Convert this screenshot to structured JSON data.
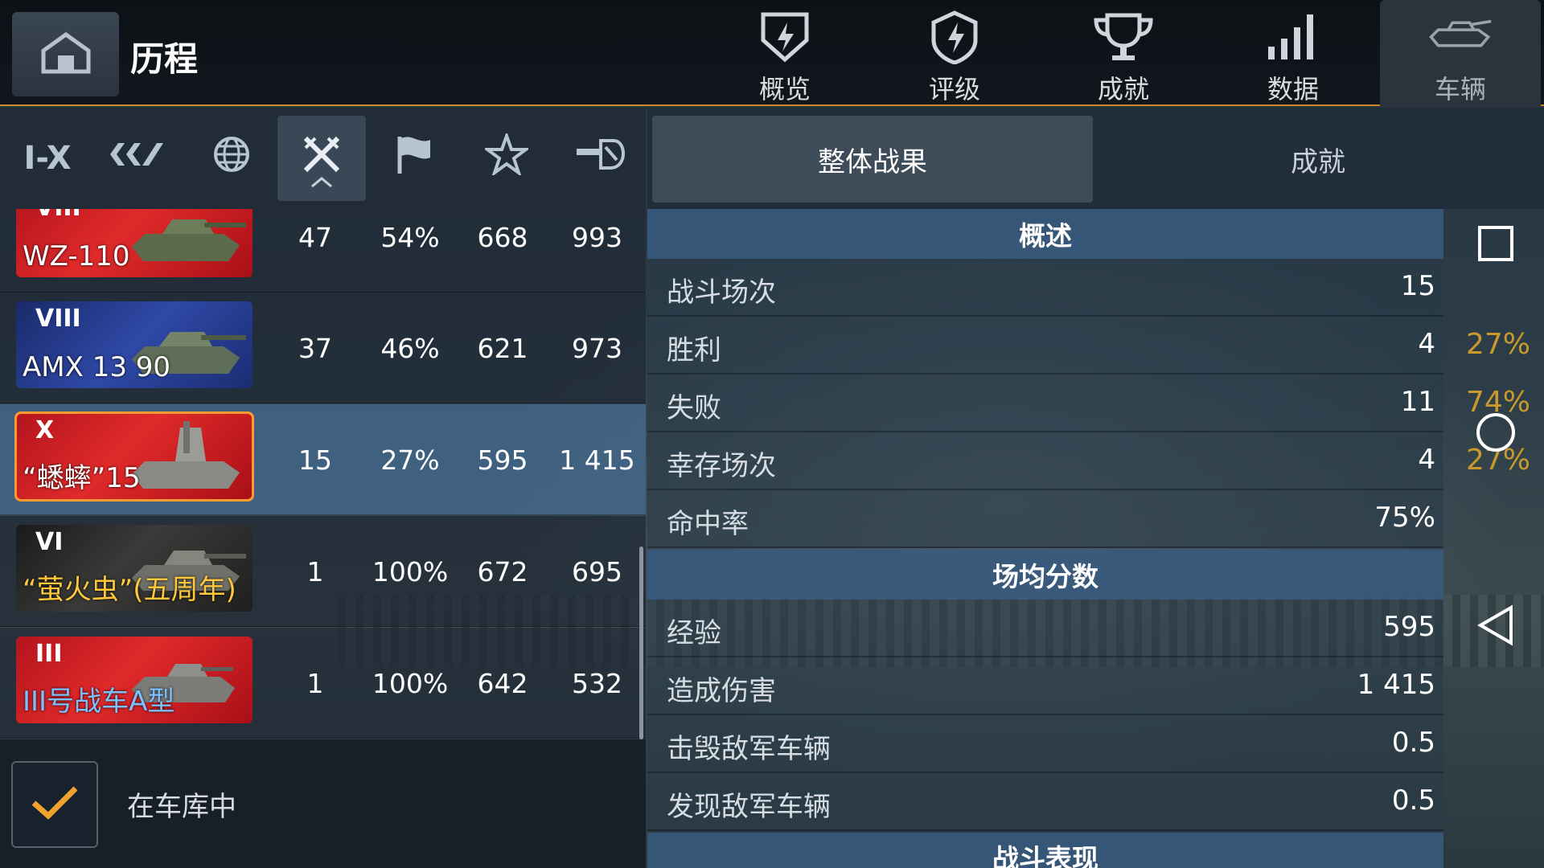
{
  "header": {
    "title": "历程",
    "nav": [
      {
        "label": "概览",
        "icon": "shield-icon"
      },
      {
        "label": "评级",
        "icon": "rating-icon"
      },
      {
        "label": "成就",
        "icon": "trophy-icon"
      },
      {
        "label": "数据",
        "icon": "bars-icon"
      },
      {
        "label": "车辆",
        "icon": "tank-icon"
      }
    ]
  },
  "filters": {
    "tier_label": "I-X",
    "icons": [
      "tier-filter-icon",
      "nation-icon",
      "globe-icon",
      "crossed-swords-icon",
      "flag-icon",
      "star-icon",
      "gun-icon"
    ]
  },
  "tabs": {
    "overall": "整体战果",
    "achievements": "成就"
  },
  "vehicles": [
    {
      "tier": "VIII",
      "name": "WZ-110",
      "battles": "47",
      "winrate": "54%",
      "xp": "668",
      "dmg": "993",
      "color": "red"
    },
    {
      "tier": "VIII",
      "name": "AMX 13 90",
      "battles": "37",
      "winrate": "46%",
      "xp": "621",
      "dmg": "973",
      "color": "blue"
    },
    {
      "tier": "X",
      "name": "“蟋蟀”15",
      "battles": "15",
      "winrate": "27%",
      "xp": "595",
      "dmg": "1 415",
      "color": "red"
    },
    {
      "tier": "VI",
      "name": "“萤火虫”(五周年)",
      "battles": "1",
      "winrate": "100%",
      "xp": "672",
      "dmg": "695",
      "color": "black"
    },
    {
      "tier": "III",
      "name": "III号战车A型",
      "battles": "1",
      "winrate": "100%",
      "xp": "642",
      "dmg": "532",
      "color": "red"
    }
  ],
  "garage_filter": {
    "label": "在车库中",
    "checked": true
  },
  "stats": {
    "overview_title": "概述",
    "battles": {
      "label": "战斗场次",
      "value": "15"
    },
    "wins": {
      "label": "胜利",
      "value": "4",
      "pct": "27%"
    },
    "losses": {
      "label": "失败",
      "value": "11",
      "pct": "74%"
    },
    "survived": {
      "label": "幸存场次",
      "value": "4",
      "pct": "27%"
    },
    "hit_rate": {
      "label": "命中率",
      "value": "75%"
    },
    "avg_title": "场均分数",
    "xp": {
      "label": "经验",
      "value": "595"
    },
    "damage": {
      "label": "造成伤害",
      "value": "1 415"
    },
    "kills": {
      "label": "击毁敌军车辆",
      "value": "0.5"
    },
    "spotted": {
      "label": "发现敌军车辆",
      "value": "0.5"
    },
    "perf_title": "战斗表现"
  },
  "colors": {
    "accent": "#c98a2b",
    "selected_row": "#466e96",
    "pct_gold": "#c9992c"
  }
}
